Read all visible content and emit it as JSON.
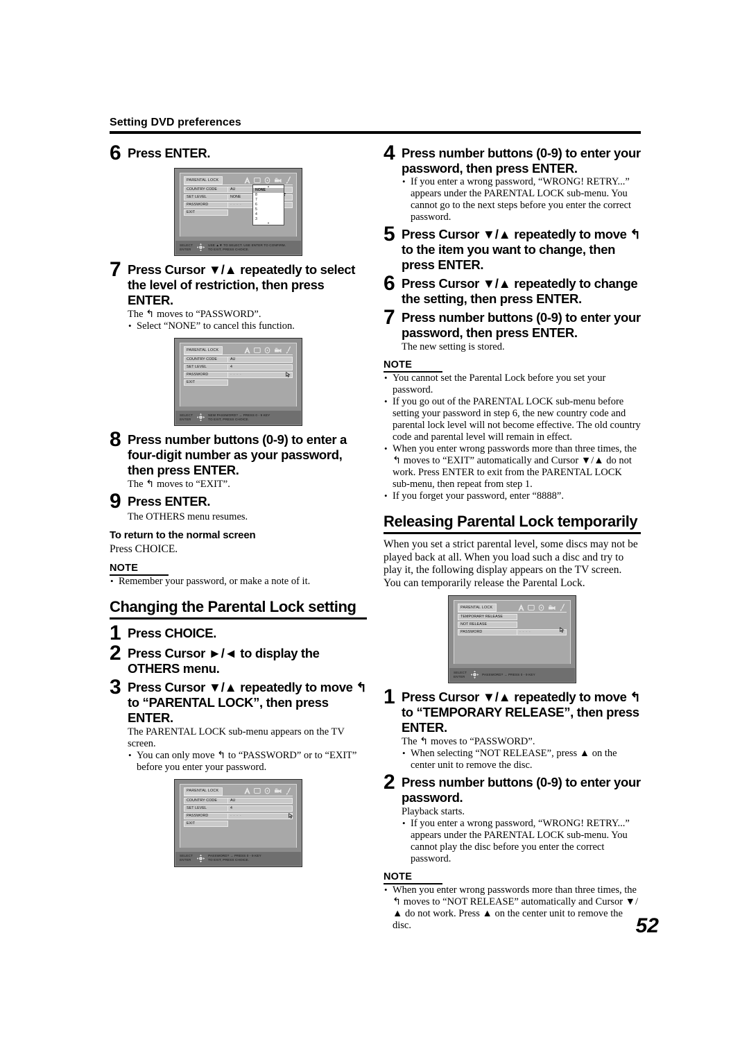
{
  "running_head": "Setting DVD preferences",
  "page_number": "52",
  "left_column": {
    "step6": {
      "num": "6",
      "text": "Press ENTER."
    },
    "step7": {
      "num": "7",
      "text": "Press Cursor ▼/▲ repeatedly to select the level of restriction, then press ENTER.",
      "sub": "The ↰ moves to “PASSWORD”.",
      "bullets": [
        "Select “NONE” to cancel this function."
      ]
    },
    "step8": {
      "num": "8",
      "text": "Press number buttons (0-9) to enter a four-digit number as your password, then press ENTER.",
      "sub": "The ↰ moves to “EXIT”."
    },
    "step9": {
      "num": "9",
      "text": "Press ENTER.",
      "sub": "The OTHERS menu resumes."
    },
    "return_heading": "To return to the normal screen",
    "return_text": "Press CHOICE.",
    "note_label": "NOTE",
    "note_bullets": [
      "Remember your password, or make a note of it."
    ],
    "section_heading": "Changing the Parental Lock setting",
    "c_step1": {
      "num": "1",
      "text": "Press CHOICE."
    },
    "c_step2": {
      "num": "2",
      "text": "Press Cursor ►/◄ to display the OTHERS menu."
    },
    "c_step3": {
      "num": "3",
      "text": "Press Cursor ▼/▲ repeatedly to move ↰ to “PARENTAL LOCK”, then press ENTER.",
      "sub": "The PARENTAL LOCK sub-menu appears on the TV screen.",
      "bullets": [
        "You can only move ↰ to “PASSWORD” or to “EXIT” before you enter your password."
      ]
    }
  },
  "right_column": {
    "step4": {
      "num": "4",
      "text": "Press number buttons (0-9) to enter your password, then press ENTER.",
      "bullets": [
        "If you enter a wrong password, “WRONG! RETRY...” appears under the PARENTAL LOCK sub-menu. You cannot go to the next steps before you enter the correct password."
      ]
    },
    "step5": {
      "num": "5",
      "text": "Press Cursor ▼/▲ repeatedly to move ↰ to the item you want to change, then press ENTER."
    },
    "step6": {
      "num": "6",
      "text": "Press Cursor ▼/▲ repeatedly to change the setting, then press ENTER."
    },
    "step7": {
      "num": "7",
      "text": "Press number buttons (0-9) to enter your password, then press ENTER.",
      "sub": "The new setting is stored."
    },
    "note_label": "NOTE",
    "note_bullets": [
      "You cannot set the Parental Lock before you set your password.",
      "If you go out of the PARENTAL LOCK sub-menu before setting your password in step 6, the new country code and parental lock level will not become effective. The old country code and parental level will remain in effect.",
      "When you enter wrong passwords more than three times, the ↰ moves to “EXIT” automatically and Cursor ▼/▲ do not work. Press ENTER to exit from the PARENTAL LOCK sub-menu, then repeat from step 1.",
      "If you forget your password, enter “8888”."
    ],
    "section_heading": "Releasing Parental Lock temporarily",
    "section_intro": "When you set a strict parental level, some discs may not be played back at all. When you load such a disc and try to play it, the following display appears on the TV screen. You can temporarily release the Parental Lock.",
    "r_step1": {
      "num": "1",
      "text": "Press Cursor ▼/▲ repeatedly to move ↰ to “TEMPORARY RELEASE”, then press ENTER.",
      "sub": "The ↰ moves to “PASSWORD”.",
      "bullets": [
        "When selecting “NOT RELEASE”, press ▲ on the center unit to remove the disc."
      ]
    },
    "r_step2": {
      "num": "2",
      "text": "Press number buttons (0-9) to enter your password.",
      "sub": "Playback starts.",
      "bullets": [
        "If you enter a wrong password, “WRONG! RETRY...” appears under the PARENTAL LOCK sub-menu. You cannot play the disc before you enter the correct password."
      ]
    },
    "note2_label": "NOTE",
    "note2_bullets": [
      "When you enter wrong passwords more than three times, the ↰ moves to “NOT RELEASE” automatically and Cursor ▼/▲ do not work. Press ▲ on the center unit to remove the disc."
    ]
  },
  "osd_screens": {
    "screen1": {
      "title": "PARENTAL LOCK",
      "rows": [
        {
          "label": "COUNTRY CODE",
          "value": "AU"
        },
        {
          "label": "SET LEVEL",
          "value": "NONE"
        },
        {
          "label": "PASSWORD",
          "value": "- - - -"
        },
        {
          "label": "EXIT",
          "value": ""
        }
      ],
      "dropdown_options": [
        "NONE",
        "8",
        "7",
        "6",
        "5",
        "4",
        "3"
      ],
      "dropdown_selected": "NONE",
      "bottom_keys": [
        "SELECT",
        "ENTER"
      ],
      "bottom_message": "USE ▲▼ TO SELECT.  USE ENTER TO CONFIRM.\nTO EXIT, PRESS CHOICE."
    },
    "screen2": {
      "title": "PARENTAL LOCK",
      "rows": [
        {
          "label": "COUNTRY CODE",
          "value": "AU"
        },
        {
          "label": "SET LEVEL",
          "value": "4"
        },
        {
          "label": "PASSWORD",
          "value": "- - - -"
        },
        {
          "label": "EXIT",
          "value": ""
        }
      ],
      "bottom_keys": [
        "SELECT",
        "ENTER"
      ],
      "bottom_message": "NEW PASSWORD?  → PRESS 0 - 9 KEY\nTO EXIT, PRESS CHOICE."
    },
    "screen3": {
      "title": "PARENTAL LOCK",
      "rows": [
        {
          "label": "COUNTRY CODE",
          "value": "AU"
        },
        {
          "label": "SET LEVEL",
          "value": "4"
        },
        {
          "label": "PASSWORD",
          "value": "- - - -"
        },
        {
          "label": "EXIT",
          "value": ""
        }
      ],
      "bottom_keys": [
        "SELECT",
        "ENTER"
      ],
      "bottom_message": "PASSWORD?  → PRESS 0 - 9 KEY\nTO EXIT, PRESS CHOICE."
    },
    "screen4": {
      "title": "PARENTAL LOCK",
      "rows": [
        {
          "label": "TEMPORARY RELEASE",
          "value": ""
        },
        {
          "label": "NOT RELEASE",
          "value": ""
        },
        {
          "label": "PASSWORD",
          "value": "- - - -"
        }
      ],
      "bottom_keys": [
        "SELECT",
        "ENTER"
      ],
      "bottom_message": "PASSWORD?  → PRESS 0 - 9 KEY"
    },
    "icon_names": [
      "audio-language-icon",
      "subtitle-screen-icon",
      "disc-icon",
      "camera-angle-icon",
      "setup-wrench-icon"
    ]
  }
}
